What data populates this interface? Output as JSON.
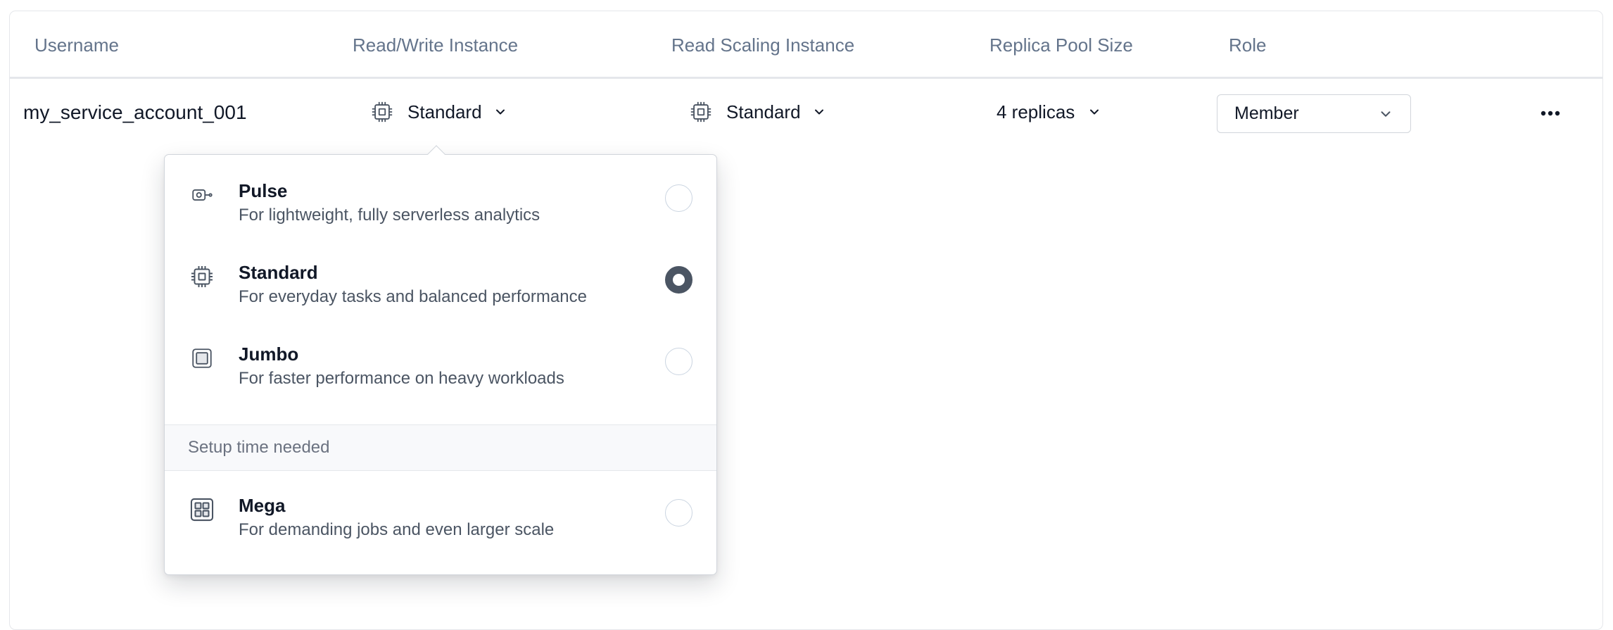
{
  "table": {
    "headers": [
      "Username",
      "Read/Write Instance",
      "Read Scaling Instance",
      "Replica Pool Size",
      "Role"
    ],
    "row": {
      "username": "my_service_account_001",
      "read_write_instance": {
        "label": "Standard",
        "icon": "chip-icon"
      },
      "read_scaling_instance": {
        "label": "Standard",
        "icon": "chip-icon"
      },
      "replica_pool_size": "4 replicas",
      "role": "Member",
      "more_icon": "ellipsis-icon"
    }
  },
  "dropdown": {
    "options": [
      {
        "title": "Pulse",
        "description": "For lightweight, fully serverless analytics",
        "icon": "pulse-icon",
        "selected": false
      },
      {
        "title": "Standard",
        "description": "For everyday tasks and balanced performance",
        "icon": "chip-icon",
        "selected": true
      },
      {
        "title": "Jumbo",
        "description": "For faster performance on heavy workloads",
        "icon": "jumbo-icon",
        "selected": false
      }
    ],
    "section_label": "Setup time needed",
    "extra_options": [
      {
        "title": "Mega",
        "description": "For demanding jobs and even larger scale",
        "icon": "grid-icon",
        "selected": false
      }
    ]
  },
  "colors": {
    "border": "#e5e7eb",
    "header_text": "#64748b",
    "text": "#111827",
    "muted": "#4b5563",
    "radio_selected": "#4b5563"
  }
}
